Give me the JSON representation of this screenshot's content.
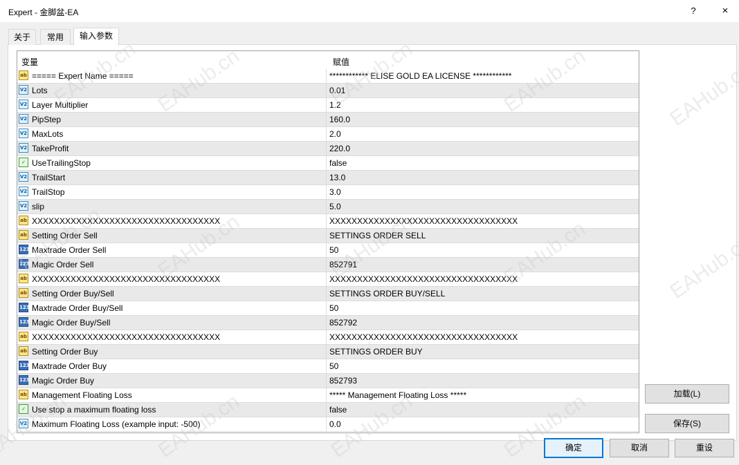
{
  "window": {
    "title": "Expert - 金脚盆-EA",
    "help_icon": "?",
    "close_icon": "×"
  },
  "tabs": [
    {
      "label": "关于",
      "active": false
    },
    {
      "label": "常用",
      "active": false
    },
    {
      "label": "输入参数",
      "active": true
    }
  ],
  "grid": {
    "col_variable": "变量",
    "col_value": "赋值",
    "rows": [
      {
        "icon": "string-type-icon",
        "name": "===== Expert Name =====",
        "value": "************ ELISE GOLD EA LICENSE ************"
      },
      {
        "icon": "double-type-icon",
        "name": "Lots",
        "value": "0.01"
      },
      {
        "icon": "double-type-icon",
        "name": "Layer Multiplier",
        "value": "1.2"
      },
      {
        "icon": "double-type-icon",
        "name": "PipStep",
        "value": "160.0"
      },
      {
        "icon": "double-type-icon",
        "name": "MaxLots",
        "value": "2.0"
      },
      {
        "icon": "double-type-icon",
        "name": "TakeProfit",
        "value": "220.0"
      },
      {
        "icon": "bool-type-icon",
        "name": "UseTrailingStop",
        "value": "false"
      },
      {
        "icon": "double-type-icon",
        "name": "TrailStart",
        "value": "13.0"
      },
      {
        "icon": "double-type-icon",
        "name": "TrailStop",
        "value": "3.0"
      },
      {
        "icon": "double-type-icon",
        "name": "slip",
        "value": "5.0"
      },
      {
        "icon": "string-type-icon",
        "name": "XXXXXXXXXXXXXXXXXXXXXXXXXXXXXXXXXX",
        "value": "XXXXXXXXXXXXXXXXXXXXXXXXXXXXXXXXXX"
      },
      {
        "icon": "string-type-icon",
        "name": "Setting Order Sell",
        "value": "SETTINGS ORDER SELL"
      },
      {
        "icon": "int-type-icon",
        "name": "Maxtrade Order Sell",
        "value": "50"
      },
      {
        "icon": "int-type-icon",
        "name": "Magic Order Sell",
        "value": "852791"
      },
      {
        "icon": "string-type-icon",
        "name": "XXXXXXXXXXXXXXXXXXXXXXXXXXXXXXXXXX",
        "value": "XXXXXXXXXXXXXXXXXXXXXXXXXXXXXXXXXX"
      },
      {
        "icon": "string-type-icon",
        "name": "Setting Order Buy/Sell",
        "value": "SETTINGS ORDER BUY/SELL"
      },
      {
        "icon": "int-type-icon",
        "name": "Maxtrade Order Buy/Sell",
        "value": "50"
      },
      {
        "icon": "int-type-icon",
        "name": "Magic Order Buy/Sell",
        "value": "852792"
      },
      {
        "icon": "string-type-icon",
        "name": "XXXXXXXXXXXXXXXXXXXXXXXXXXXXXXXXXX",
        "value": "XXXXXXXXXXXXXXXXXXXXXXXXXXXXXXXXXX"
      },
      {
        "icon": "string-type-icon",
        "name": "Setting Order Buy",
        "value": "SETTINGS ORDER BUY"
      },
      {
        "icon": "int-type-icon",
        "name": "Maxtrade Order Buy",
        "value": "50"
      },
      {
        "icon": "int-type-icon",
        "name": "Magic Order Buy",
        "value": "852793"
      },
      {
        "icon": "string-type-icon",
        "name": "Management Floating Loss",
        "value": "***** Management Floating Loss *****"
      },
      {
        "icon": "bool-type-icon",
        "name": "Use stop a maximum floating loss",
        "value": "false"
      },
      {
        "icon": "double-type-icon",
        "name": "Maximum Floating Loss (example input: -500)",
        "value": "0.0"
      }
    ]
  },
  "icon_glyphs": {
    "string-type-icon": "ab",
    "double-type-icon": "V2",
    "int-type-icon": "123",
    "bool-type-icon": "✓"
  },
  "buttons": {
    "load": "加载(L)",
    "save": "保存(S)",
    "ok": "确定",
    "cancel": "取消",
    "reset": "重设"
  },
  "watermark": "EAHub.cn",
  "colors": {
    "default_button_border": "#0078d7",
    "alt_row": "#e9e9e9"
  }
}
